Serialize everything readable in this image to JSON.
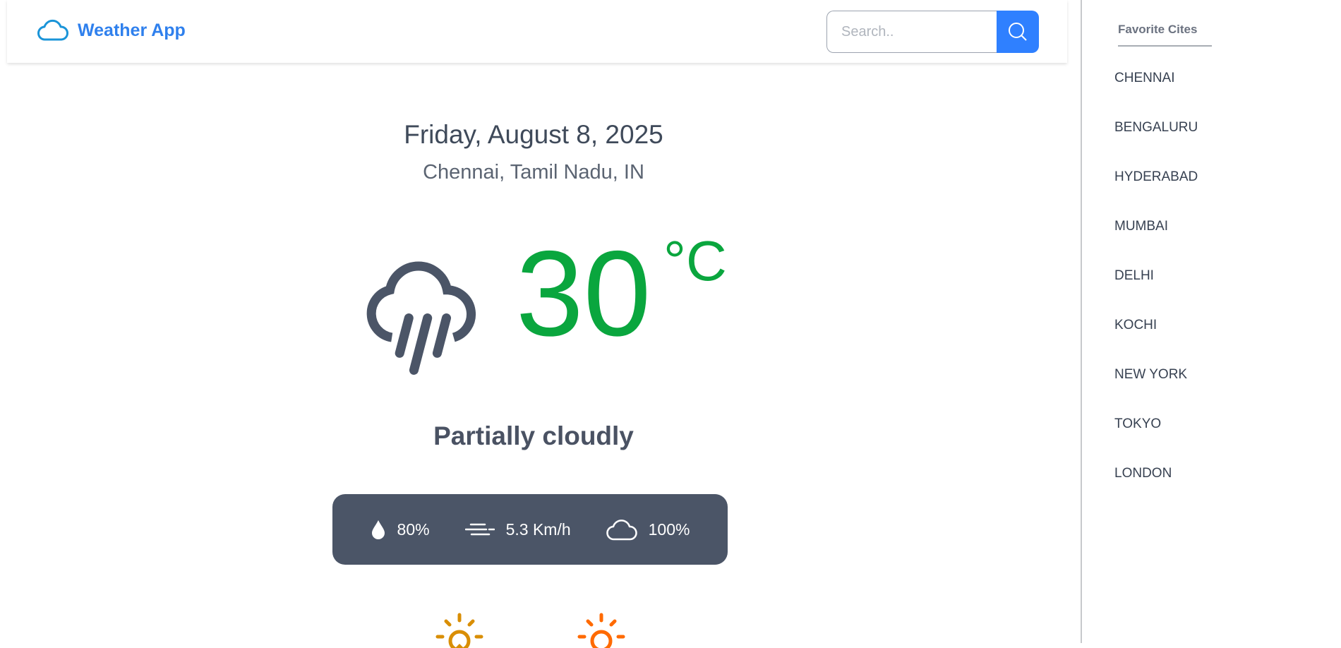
{
  "header": {
    "app_title": "Weather App",
    "logo_icon": "cloud-icon",
    "search_placeholder": "Search..",
    "search_icon": "search-icon"
  },
  "sidebar": {
    "title": "Favorite Cites",
    "cities": [
      "CHENNAI",
      "BENGALURU",
      "HYDERABAD",
      "MUMBAI",
      "DELHI",
      "KOCHI",
      "NEW YORK",
      "TOKYO",
      "LONDON"
    ]
  },
  "weather": {
    "date": "Friday, August 8, 2025",
    "location": "Chennai, Tamil Nadu, IN",
    "icon": "cloud-rain-icon",
    "temperature": "30",
    "unit": "°C",
    "condition": "Partially cloudly",
    "humidity": "80%",
    "wind": "5.3 Km/h",
    "clouds": "100%"
  },
  "colors": {
    "accent": "#2f80ff",
    "temperature": "#0aa63e",
    "stats_bg": "#4b5567",
    "sunrise": "#d98e04",
    "sunset": "#ff6a00"
  }
}
